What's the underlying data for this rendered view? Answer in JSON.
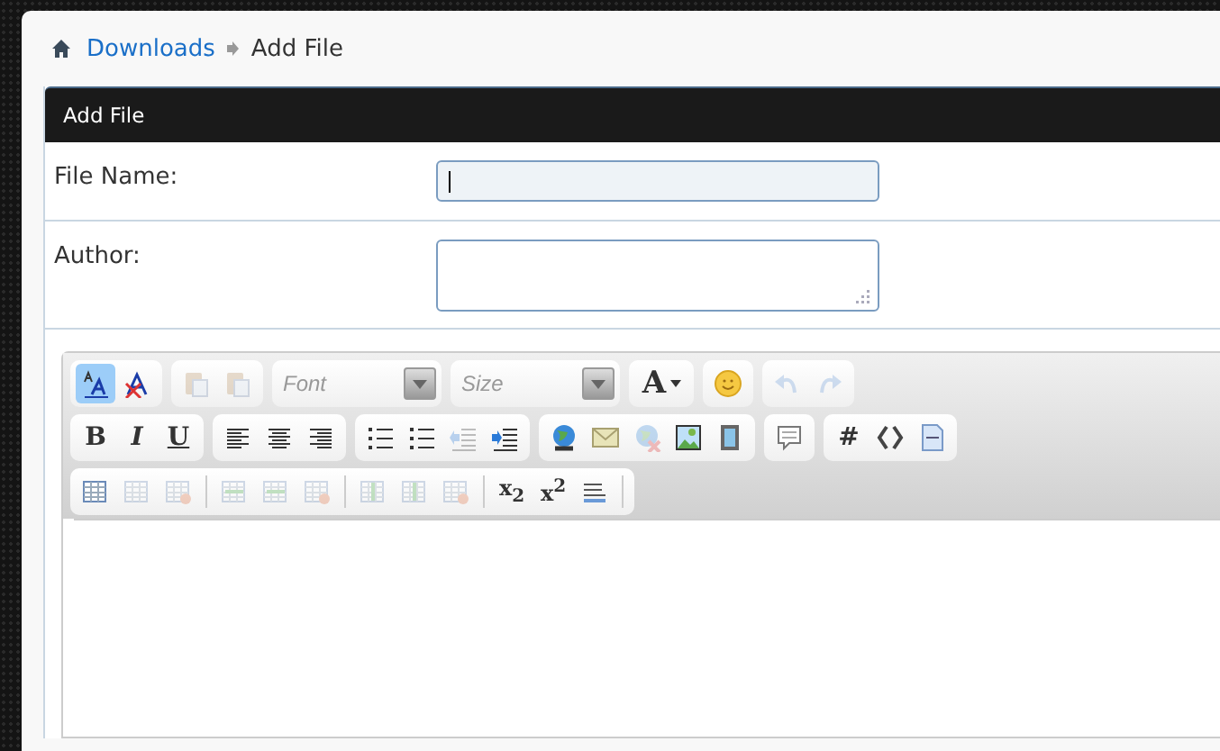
{
  "breadcrumb": {
    "items": [
      {
        "label": "Downloads",
        "kind": "link"
      },
      {
        "label": "Add File",
        "kind": "current"
      }
    ]
  },
  "panel": {
    "title": "Add File"
  },
  "form": {
    "fields": [
      {
        "label": "File Name:",
        "kind": "input",
        "focused": true
      },
      {
        "label": "Author:",
        "kind": "textarea",
        "focused": false
      }
    ]
  },
  "toolbar": {
    "rows": [
      [
        {
          "items": [
            {
              "kind": "format",
              "selected": true,
              "disabled": false
            },
            {
              "kind": "remove-format",
              "selected": false,
              "disabled": false
            }
          ]
        },
        {
          "items": [
            {
              "kind": "paste",
              "selected": false,
              "disabled": true
            },
            {
              "kind": "paste-word",
              "selected": false,
              "disabled": true
            }
          ]
        },
        {
          "items": [
            {
              "kind": "dropdown",
              "placeholder": "Font",
              "disabled": false
            }
          ]
        },
        {
          "items": [
            {
              "kind": "dropdown",
              "placeholder": "Size",
              "disabled": false
            }
          ]
        },
        {
          "items": [
            {
              "kind": "text-color",
              "label": "A",
              "selected": false,
              "disabled": false
            }
          ]
        },
        {
          "items": [
            {
              "kind": "smiley",
              "selected": false,
              "disabled": false
            }
          ]
        },
        {
          "items": [
            {
              "kind": "undo",
              "selected": false,
              "disabled": true
            },
            {
              "kind": "redo",
              "selected": false,
              "disabled": true
            }
          ]
        }
      ],
      [
        {
          "items": [
            {
              "kind": "bold",
              "label": "B",
              "selected": false,
              "disabled": false
            },
            {
              "kind": "italic",
              "label": "I",
              "selected": false,
              "disabled": false
            },
            {
              "kind": "underline",
              "label": "U",
              "selected": false,
              "disabled": false
            }
          ]
        },
        {
          "items": [
            {
              "kind": "align-left",
              "selected": false,
              "disabled": false
            },
            {
              "kind": "align-center",
              "selected": false,
              "disabled": false
            },
            {
              "kind": "align-right",
              "selected": false,
              "disabled": false
            }
          ]
        },
        {
          "items": [
            {
              "kind": "ordered-list",
              "selected": false,
              "disabled": false
            },
            {
              "kind": "bullet-list",
              "selected": false,
              "disabled": false
            },
            {
              "kind": "outdent",
              "selected": false,
              "disabled": true
            },
            {
              "kind": "indent",
              "selected": false,
              "disabled": false
            }
          ]
        },
        {
          "items": [
            {
              "kind": "link",
              "selected": false,
              "disabled": false
            },
            {
              "kind": "email",
              "selected": false,
              "disabled": false
            },
            {
              "kind": "unlink",
              "selected": false,
              "disabled": true
            },
            {
              "kind": "image",
              "selected": false,
              "disabled": false
            },
            {
              "kind": "video",
              "selected": false,
              "disabled": false
            }
          ]
        },
        {
          "items": [
            {
              "kind": "quote",
              "selected": false,
              "disabled": false
            }
          ]
        },
        {
          "items": [
            {
              "kind": "code",
              "label": "#",
              "selected": false,
              "disabled": false
            },
            {
              "kind": "html",
              "selected": false,
              "disabled": false
            },
            {
              "kind": "php",
              "selected": false,
              "disabled": false
            }
          ]
        }
      ],
      [
        {
          "items": [
            {
              "kind": "table",
              "selected": false,
              "disabled": false
            },
            {
              "kind": "table",
              "selected": false,
              "disabled": true
            },
            {
              "kind": "table-delete",
              "selected": false,
              "disabled": true
            },
            {
              "kind": "separator"
            },
            {
              "kind": "row-before",
              "selected": false,
              "disabled": true
            },
            {
              "kind": "row-after",
              "selected": false,
              "disabled": true
            },
            {
              "kind": "row-delete",
              "selected": false,
              "disabled": true
            },
            {
              "kind": "separator"
            },
            {
              "kind": "col-before",
              "selected": false,
              "disabled": true
            },
            {
              "kind": "col-after",
              "selected": false,
              "disabled": true
            },
            {
              "kind": "col-delete",
              "selected": false,
              "disabled": true
            },
            {
              "kind": "separator"
            },
            {
              "kind": "script",
              "label": "x$_{2}$",
              "selected": false,
              "disabled": false
            },
            {
              "kind": "script",
              "label": "x$^{2}$",
              "selected": false,
              "disabled": false
            },
            {
              "kind": "rule",
              "selected": false,
              "disabled": false
            },
            {
              "kind": "separator"
            }
          ]
        }
      ]
    ]
  }
}
